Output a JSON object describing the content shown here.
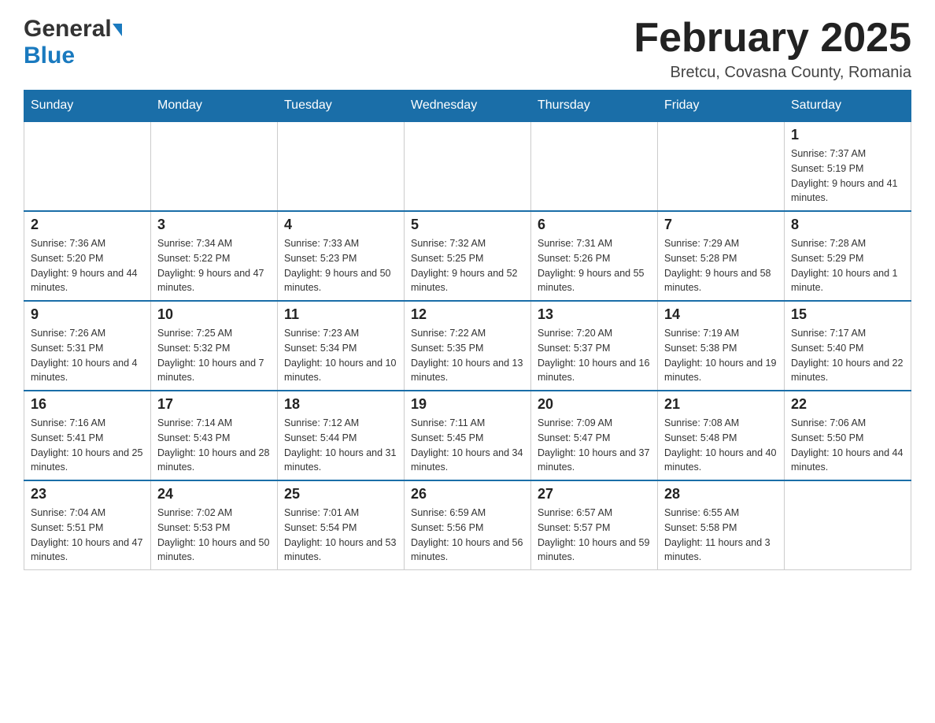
{
  "header": {
    "logo_general": "General",
    "logo_blue": "Blue",
    "title": "February 2025",
    "location": "Bretcu, Covasna County, Romania"
  },
  "days_of_week": [
    "Sunday",
    "Monday",
    "Tuesday",
    "Wednesday",
    "Thursday",
    "Friday",
    "Saturday"
  ],
  "weeks": [
    {
      "days": [
        {
          "number": "",
          "info": ""
        },
        {
          "number": "",
          "info": ""
        },
        {
          "number": "",
          "info": ""
        },
        {
          "number": "",
          "info": ""
        },
        {
          "number": "",
          "info": ""
        },
        {
          "number": "",
          "info": ""
        },
        {
          "number": "1",
          "info": "Sunrise: 7:37 AM\nSunset: 5:19 PM\nDaylight: 9 hours and 41 minutes."
        }
      ]
    },
    {
      "days": [
        {
          "number": "2",
          "info": "Sunrise: 7:36 AM\nSunset: 5:20 PM\nDaylight: 9 hours and 44 minutes."
        },
        {
          "number": "3",
          "info": "Sunrise: 7:34 AM\nSunset: 5:22 PM\nDaylight: 9 hours and 47 minutes."
        },
        {
          "number": "4",
          "info": "Sunrise: 7:33 AM\nSunset: 5:23 PM\nDaylight: 9 hours and 50 minutes."
        },
        {
          "number": "5",
          "info": "Sunrise: 7:32 AM\nSunset: 5:25 PM\nDaylight: 9 hours and 52 minutes."
        },
        {
          "number": "6",
          "info": "Sunrise: 7:31 AM\nSunset: 5:26 PM\nDaylight: 9 hours and 55 minutes."
        },
        {
          "number": "7",
          "info": "Sunrise: 7:29 AM\nSunset: 5:28 PM\nDaylight: 9 hours and 58 minutes."
        },
        {
          "number": "8",
          "info": "Sunrise: 7:28 AM\nSunset: 5:29 PM\nDaylight: 10 hours and 1 minute."
        }
      ]
    },
    {
      "days": [
        {
          "number": "9",
          "info": "Sunrise: 7:26 AM\nSunset: 5:31 PM\nDaylight: 10 hours and 4 minutes."
        },
        {
          "number": "10",
          "info": "Sunrise: 7:25 AM\nSunset: 5:32 PM\nDaylight: 10 hours and 7 minutes."
        },
        {
          "number": "11",
          "info": "Sunrise: 7:23 AM\nSunset: 5:34 PM\nDaylight: 10 hours and 10 minutes."
        },
        {
          "number": "12",
          "info": "Sunrise: 7:22 AM\nSunset: 5:35 PM\nDaylight: 10 hours and 13 minutes."
        },
        {
          "number": "13",
          "info": "Sunrise: 7:20 AM\nSunset: 5:37 PM\nDaylight: 10 hours and 16 minutes."
        },
        {
          "number": "14",
          "info": "Sunrise: 7:19 AM\nSunset: 5:38 PM\nDaylight: 10 hours and 19 minutes."
        },
        {
          "number": "15",
          "info": "Sunrise: 7:17 AM\nSunset: 5:40 PM\nDaylight: 10 hours and 22 minutes."
        }
      ]
    },
    {
      "days": [
        {
          "number": "16",
          "info": "Sunrise: 7:16 AM\nSunset: 5:41 PM\nDaylight: 10 hours and 25 minutes."
        },
        {
          "number": "17",
          "info": "Sunrise: 7:14 AM\nSunset: 5:43 PM\nDaylight: 10 hours and 28 minutes."
        },
        {
          "number": "18",
          "info": "Sunrise: 7:12 AM\nSunset: 5:44 PM\nDaylight: 10 hours and 31 minutes."
        },
        {
          "number": "19",
          "info": "Sunrise: 7:11 AM\nSunset: 5:45 PM\nDaylight: 10 hours and 34 minutes."
        },
        {
          "number": "20",
          "info": "Sunrise: 7:09 AM\nSunset: 5:47 PM\nDaylight: 10 hours and 37 minutes."
        },
        {
          "number": "21",
          "info": "Sunrise: 7:08 AM\nSunset: 5:48 PM\nDaylight: 10 hours and 40 minutes."
        },
        {
          "number": "22",
          "info": "Sunrise: 7:06 AM\nSunset: 5:50 PM\nDaylight: 10 hours and 44 minutes."
        }
      ]
    },
    {
      "days": [
        {
          "number": "23",
          "info": "Sunrise: 7:04 AM\nSunset: 5:51 PM\nDaylight: 10 hours and 47 minutes."
        },
        {
          "number": "24",
          "info": "Sunrise: 7:02 AM\nSunset: 5:53 PM\nDaylight: 10 hours and 50 minutes."
        },
        {
          "number": "25",
          "info": "Sunrise: 7:01 AM\nSunset: 5:54 PM\nDaylight: 10 hours and 53 minutes."
        },
        {
          "number": "26",
          "info": "Sunrise: 6:59 AM\nSunset: 5:56 PM\nDaylight: 10 hours and 56 minutes."
        },
        {
          "number": "27",
          "info": "Sunrise: 6:57 AM\nSunset: 5:57 PM\nDaylight: 10 hours and 59 minutes."
        },
        {
          "number": "28",
          "info": "Sunrise: 6:55 AM\nSunset: 5:58 PM\nDaylight: 11 hours and 3 minutes."
        },
        {
          "number": "",
          "info": ""
        }
      ]
    }
  ]
}
